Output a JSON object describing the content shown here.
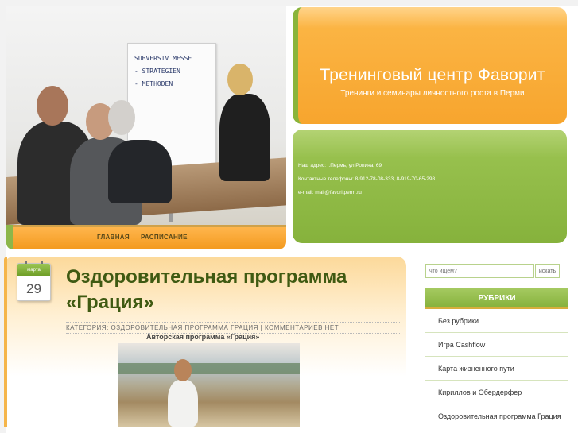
{
  "header": {
    "site_title": "Тренинговый центр Фаворит",
    "tagline": "Тренинги и семинары личностного роста в Перми",
    "flipchart_lines": [
      "SUBVERSIV MESSE",
      "- STRATEGIEN",
      "- METHODEN"
    ]
  },
  "nav": {
    "home": "ГЛАВНАЯ",
    "schedule": "РАСПИСАНИЕ"
  },
  "contacts": {
    "address": "Наш адрес:  г.Пермь, ул.Ропина, 69",
    "phones": "Контактные телефоны: 8-912-78-08-333, 8-919-70-65-298",
    "email": "e-mail: mail@favoritperm.ru"
  },
  "post": {
    "month": "марта",
    "day": "29",
    "title": "Оздоровительная программа «Грация»",
    "category_label": "КАТЕГОРИЯ:",
    "category_value": "ОЗДОРОВИТЕЛЬНАЯ ПРОГРАММА ГРАЦИЯ",
    "separator": "|",
    "comments": "КОММЕНТАРИЕВ НЕТ",
    "intro": "Авторская программа «Грация»"
  },
  "sidebar": {
    "search_placeholder": "что ищем?",
    "search_button": "искать",
    "rubrics_heading": "РУБРИКИ",
    "rubrics": [
      "Без рубрики",
      "Игра Cashflow",
      "Карта жизненного пути",
      "Кириллов и Обердерфер",
      "Оздоровительная программа Грация"
    ]
  },
  "colors": {
    "orange": "#f7a52e",
    "green": "#86b23c",
    "title_green": "#3f5a12"
  }
}
